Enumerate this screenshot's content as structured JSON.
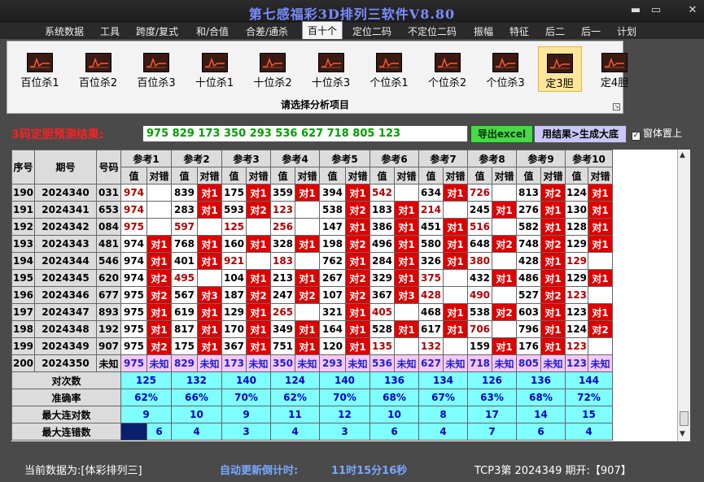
{
  "window": {
    "title": "第七感福彩3D排列三软件V8.80",
    "min_glyph": "▬",
    "max_glyph": "▭",
    "close_glyph": "✕"
  },
  "menu": [
    "系统数据",
    "工具",
    "跨度/复式",
    "和/合值",
    "合差/通杀",
    "百十个",
    "定位二码",
    "不定位二码",
    "振幅",
    "特征",
    "后二",
    "后一",
    "计划"
  ],
  "menu_active_index": 5,
  "ribbon": {
    "tools": [
      "百位杀1",
      "百位杀2",
      "百位杀3",
      "十位杀1",
      "十位杀2",
      "十位杀3",
      "个位杀1",
      "个位杀2",
      "个位杀3",
      "定3胆",
      "定4胆"
    ],
    "active_index": 9,
    "caption": "请选择分析项目",
    "launcher": "↘"
  },
  "prediction": {
    "label": "3码定胆预测结果:",
    "value": "975 829 173 350 293 536 627 718 805 123",
    "export_label": "导出excel",
    "generate_label": "用结果>生成大底",
    "ontop_label": "窗体置上",
    "ontop_checked": true,
    "check_glyph": "✓"
  },
  "table": {
    "headers": [
      "序号",
      "期号",
      "号码"
    ],
    "refs": [
      "参考1",
      "参考2",
      "参考3",
      "参考4",
      "参考5",
      "参考6",
      "参考7",
      "参考8",
      "参考9",
      "参考10"
    ],
    "sub": [
      "值",
      "对错"
    ],
    "rows": [
      {
        "no": "190",
        "issue": "2024340",
        "num": "031",
        "cells": [
          [
            "974",
            ""
          ],
          [
            "839",
            "对1"
          ],
          [
            "175",
            "对1"
          ],
          [
            "359",
            "对1"
          ],
          [
            "394",
            "对1"
          ],
          [
            "542",
            ""
          ],
          [
            "634",
            "对1"
          ],
          [
            "726",
            ""
          ],
          [
            "813",
            "对2"
          ],
          [
            "124",
            "对1"
          ]
        ]
      },
      {
        "no": "191",
        "issue": "2024341",
        "num": "653",
        "cells": [
          [
            "974",
            ""
          ],
          [
            "283",
            "对1"
          ],
          [
            "593",
            "对2"
          ],
          [
            "123",
            ""
          ],
          [
            "538",
            "对2"
          ],
          [
            "183",
            "对1"
          ],
          [
            "214",
            ""
          ],
          [
            "245",
            "对1"
          ],
          [
            "276",
            "对1"
          ],
          [
            "130",
            "对1"
          ]
        ]
      },
      {
        "no": "192",
        "issue": "2024342",
        "num": "084",
        "cells": [
          [
            "975",
            ""
          ],
          [
            "597",
            ""
          ],
          [
            "125",
            ""
          ],
          [
            "256",
            ""
          ],
          [
            "147",
            "对1"
          ],
          [
            "386",
            "对1"
          ],
          [
            "451",
            "对1"
          ],
          [
            "516",
            ""
          ],
          [
            "582",
            "对1"
          ],
          [
            "128",
            "对1"
          ]
        ]
      },
      {
        "no": "193",
        "issue": "2024343",
        "num": "481",
        "cells": [
          [
            "974",
            "对1"
          ],
          [
            "768",
            "对1"
          ],
          [
            "160",
            "对1"
          ],
          [
            "328",
            "对1"
          ],
          [
            "198",
            "对2"
          ],
          [
            "496",
            "对1"
          ],
          [
            "580",
            "对1"
          ],
          [
            "648",
            "对2"
          ],
          [
            "748",
            "对2"
          ],
          [
            "129",
            "对1"
          ]
        ]
      },
      {
        "no": "194",
        "issue": "2024344",
        "num": "546",
        "cells": [
          [
            "974",
            "对1"
          ],
          [
            "401",
            "对1"
          ],
          [
            "921",
            ""
          ],
          [
            "183",
            ""
          ],
          [
            "762",
            "对1"
          ],
          [
            "284",
            "对1"
          ],
          [
            "326",
            "对1"
          ],
          [
            "380",
            ""
          ],
          [
            "428",
            "对1"
          ],
          [
            "129",
            ""
          ]
        ]
      },
      {
        "no": "195",
        "issue": "2024345",
        "num": "620",
        "cells": [
          [
            "974",
            "对2"
          ],
          [
            "495",
            ""
          ],
          [
            "104",
            "对1"
          ],
          [
            "213",
            "对1"
          ],
          [
            "267",
            "对2"
          ],
          [
            "329",
            "对1"
          ],
          [
            "375",
            ""
          ],
          [
            "432",
            "对1"
          ],
          [
            "486",
            "对1"
          ],
          [
            "129",
            "对1"
          ]
        ]
      },
      {
        "no": "196",
        "issue": "2024346",
        "num": "677",
        "cells": [
          [
            "975",
            "对2"
          ],
          [
            "567",
            "对3"
          ],
          [
            "187",
            "对2"
          ],
          [
            "247",
            "对2"
          ],
          [
            "107",
            "对2"
          ],
          [
            "367",
            "对3"
          ],
          [
            "428",
            ""
          ],
          [
            "490",
            ""
          ],
          [
            "527",
            "对2"
          ],
          [
            "123",
            ""
          ]
        ]
      },
      {
        "no": "197",
        "issue": "2024347",
        "num": "893",
        "cells": [
          [
            "975",
            "对1"
          ],
          [
            "619",
            "对1"
          ],
          [
            "129",
            "对1"
          ],
          [
            "265",
            ""
          ],
          [
            "321",
            "对1"
          ],
          [
            "405",
            ""
          ],
          [
            "468",
            "对1"
          ],
          [
            "538",
            "对2"
          ],
          [
            "603",
            "对1"
          ],
          [
            "123",
            "对1"
          ]
        ]
      },
      {
        "no": "198",
        "issue": "2024348",
        "num": "192",
        "cells": [
          [
            "975",
            "对1"
          ],
          [
            "817",
            "对1"
          ],
          [
            "170",
            "对1"
          ],
          [
            "349",
            "对1"
          ],
          [
            "164",
            "对1"
          ],
          [
            "528",
            "对1"
          ],
          [
            "617",
            "对1"
          ],
          [
            "706",
            ""
          ],
          [
            "796",
            "对1"
          ],
          [
            "124",
            "对2"
          ]
        ]
      },
      {
        "no": "199",
        "issue": "2024349",
        "num": "907",
        "cells": [
          [
            "975",
            "对2"
          ],
          [
            "175",
            "对1"
          ],
          [
            "367",
            "对1"
          ],
          [
            "751",
            "对1"
          ],
          [
            "120",
            "对1"
          ],
          [
            "135",
            ""
          ],
          [
            "132",
            ""
          ],
          [
            "159",
            "对1"
          ],
          [
            "176",
            "对1"
          ],
          [
            "123",
            ""
          ]
        ]
      }
    ],
    "unknown_row": {
      "no": "200",
      "issue": "2024350",
      "num": "未知",
      "cells": [
        [
          "975",
          "未知"
        ],
        [
          "829",
          "未知"
        ],
        [
          "173",
          "未知"
        ],
        [
          "350",
          "未知"
        ],
        [
          "293",
          "未知"
        ],
        [
          "536",
          "未知"
        ],
        [
          "627",
          "未知"
        ],
        [
          "718",
          "未知"
        ],
        [
          "805",
          "未知"
        ],
        [
          "123",
          "未知"
        ]
      ]
    },
    "stats": [
      {
        "label": "对次数",
        "values": [
          "125",
          "132",
          "140",
          "124",
          "140",
          "136",
          "134",
          "126",
          "136",
          "144"
        ]
      },
      {
        "label": "准确率",
        "values": [
          "62%",
          "66%",
          "70%",
          "62%",
          "70%",
          "68%",
          "67%",
          "63%",
          "68%",
          "72%"
        ]
      },
      {
        "label": "最大连对数",
        "values": [
          "9",
          "10",
          "9",
          "11",
          "12",
          "10",
          "8",
          "17",
          "14",
          "15"
        ]
      },
      {
        "label": "最大连错数",
        "values": [
          "6",
          "4",
          "3",
          "4",
          "3",
          "6",
          "4",
          "7",
          "6",
          "4"
        ]
      }
    ]
  },
  "scroll": {
    "up": "▲",
    "down": "▼"
  },
  "status": {
    "current_label": "当前数据为:[体彩排列三]",
    "countdown_label": "自动更新倒计时:",
    "countdown_value": "11时15分16秒",
    "latest": "TCP3第 2024349 期开:【907】"
  },
  "colors": {
    "hit": "#e00000",
    "prediction_text": "#00a000",
    "label_red": "#ff2020",
    "title": "#7a8cff",
    "stat_bg": "#7fffff",
    "unknown_bg": "#f6c8f6"
  }
}
